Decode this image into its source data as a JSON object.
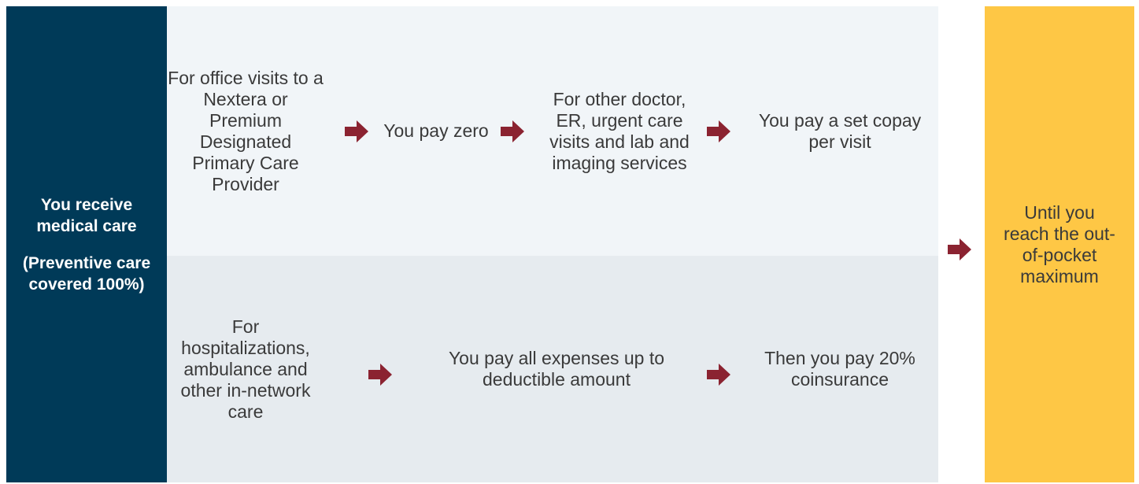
{
  "colors": {
    "navy": "#003a58",
    "top_row_bg": "#f1f5f8",
    "bottom_row_bg": "#e6ebef",
    "gold": "#fec745",
    "arrow": "#8b2331",
    "text": "#3a3a3a"
  },
  "left": {
    "line1": "You receive medical care",
    "line2": "(Preventive care covered 100%)"
  },
  "top_row": {
    "step1": "For office visits to a Nextera or Premium Designated Primary Care Provider",
    "step2": "You pay zero",
    "step3": "For other doctor, ER, urgent care visits and lab and imaging services",
    "step4": "You pay a set copay per visit"
  },
  "bottom_row": {
    "step1": "For hospitalizations, ambulance and other in-network care",
    "step2": "You pay all expenses up to deductible amount",
    "step3": "Then you pay 20% coinsurance"
  },
  "right": {
    "text": "Until you reach the out-of-pocket maximum"
  },
  "icons": {
    "arrow": "right-arrow-icon"
  }
}
